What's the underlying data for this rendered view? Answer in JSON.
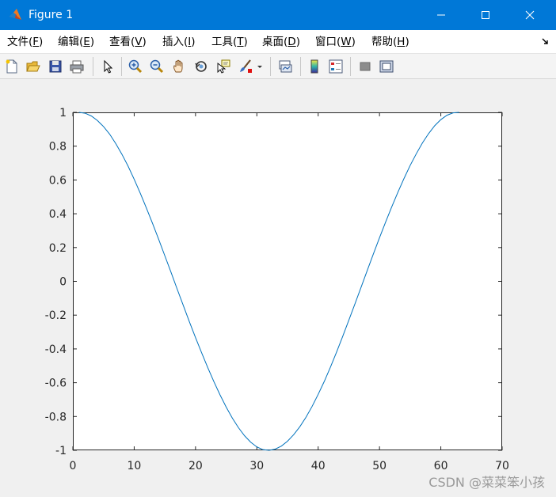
{
  "window": {
    "title": "Figure 1",
    "app_icon": "matlab-icon",
    "controls": [
      "minimize-icon",
      "maximize-icon",
      "close-icon"
    ]
  },
  "menu": {
    "items": [
      {
        "label": "文件(",
        "key": "F",
        "end": ")"
      },
      {
        "label": "编辑(",
        "key": "E",
        "end": ")"
      },
      {
        "label": "查看(",
        "key": "V",
        "end": ")"
      },
      {
        "label": "插入(",
        "key": "I",
        "end": ")"
      },
      {
        "label": "工具(",
        "key": "T",
        "end": ")"
      },
      {
        "label": "桌面(",
        "key": "D",
        "end": ")"
      },
      {
        "label": "窗口(",
        "key": "W",
        "end": ")"
      },
      {
        "label": "帮助(",
        "key": "H",
        "end": ")"
      }
    ],
    "dock_icon": "dock-arrow-icon"
  },
  "toolbar": {
    "icons": [
      "new-figure-icon",
      "open-file-icon",
      "save-icon",
      "print-icon",
      "pointer-icon",
      "zoom-in-icon",
      "zoom-out-icon",
      "pan-icon",
      "rotate-3d-icon",
      "data-cursor-icon",
      "brush-icon",
      "brush-dropdown-icon",
      "link-plot-icon",
      "colorbar-icon",
      "legend-icon",
      "hide-plot-tools-icon",
      "show-plot-tools-icon"
    ]
  },
  "chart_data": {
    "type": "line",
    "xlim": [
      0,
      70
    ],
    "ylim": [
      -1,
      1
    ],
    "xticks": [
      0,
      10,
      20,
      30,
      40,
      50,
      60,
      70
    ],
    "yticks": [
      1,
      0.8,
      0.6,
      0.4,
      0.2,
      0,
      -0.2,
      -0.4,
      -0.6,
      -0.8,
      -1
    ],
    "xtick_labels": [
      "0",
      "10",
      "20",
      "30",
      "40",
      "50",
      "60",
      "70"
    ],
    "ytick_labels": [
      "1",
      "0.8",
      "0.6",
      "0.4",
      "0.2",
      "0",
      "-0.2",
      "-0.4",
      "-0.6",
      "-0.8",
      "-1"
    ],
    "series": [
      {
        "color": "#0072bd",
        "x_start": 1,
        "x_end": 63,
        "x_step": 1,
        "y_values": [
          1.0,
          0.995,
          0.979,
          0.952,
          0.916,
          0.871,
          0.815,
          0.752,
          0.682,
          0.604,
          0.521,
          0.433,
          0.342,
          0.248,
          0.151,
          0.054,
          -0.045,
          -0.142,
          -0.239,
          -0.333,
          -0.423,
          -0.511,
          -0.594,
          -0.672,
          -0.744,
          -0.809,
          -0.866,
          -0.914,
          -0.952,
          -0.98,
          -0.996,
          -1.0,
          -0.993,
          -0.975,
          -0.946,
          -0.908,
          -0.861,
          -0.805,
          -0.741,
          -0.669,
          -0.592,
          -0.508,
          -0.419,
          -0.326,
          -0.23,
          -0.133,
          -0.035,
          0.064,
          0.162,
          0.258,
          0.351,
          0.441,
          0.527,
          0.609,
          0.686,
          0.755,
          0.819,
          0.874,
          0.921,
          0.957,
          0.983,
          0.997,
          1.0
        ]
      }
    ],
    "grid": false
  },
  "watermark": "CSDN @菜菜笨小孩"
}
